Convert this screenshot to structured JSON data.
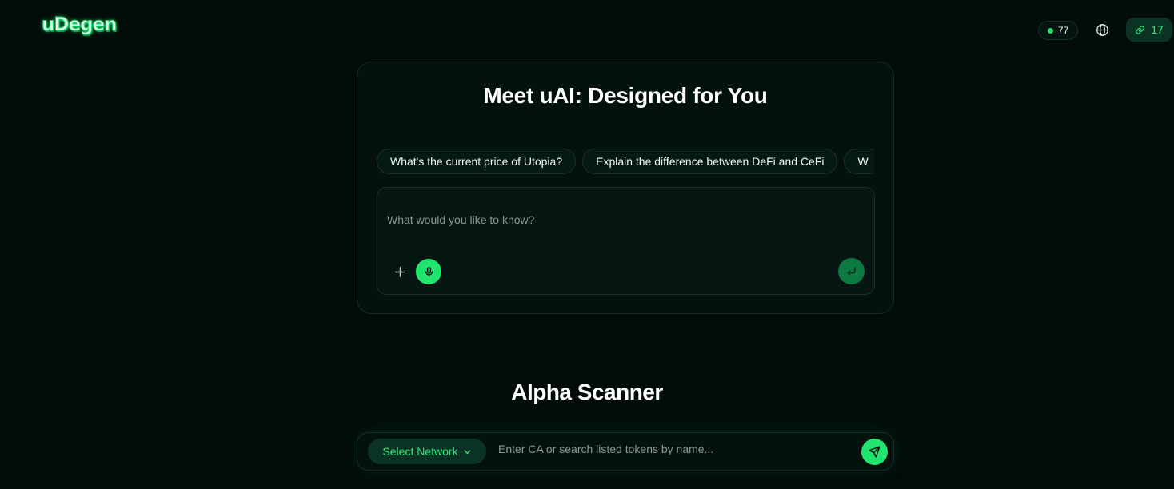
{
  "header": {
    "logo_text": "uDegen",
    "points_count": "77",
    "points_dot_color": "#1ee36d",
    "globe_icon": "globe-icon",
    "referral_count": "17",
    "referral_icon": "link-icon"
  },
  "assistant": {
    "title": "Meet uAI: Designed for You",
    "suggestions": [
      "What's the current price of Utopia?",
      "Explain the difference between DeFi and CeFi",
      "W"
    ],
    "input_placeholder": "What would you like to know?",
    "input_value": "",
    "attach_icon": "plus-icon",
    "mic_icon": "microphone-icon",
    "submit_icon": "enter-icon"
  },
  "scanner": {
    "title": "Alpha Scanner",
    "network_label": "Select Network",
    "search_placeholder": "Enter CA or search listed tokens by name...",
    "search_value": "",
    "send_icon": "send-icon"
  },
  "colors": {
    "background": "#020c09",
    "accent": "#1fe56f",
    "accent_text": "#2ee77c",
    "accent_dark": "#0b3324"
  }
}
